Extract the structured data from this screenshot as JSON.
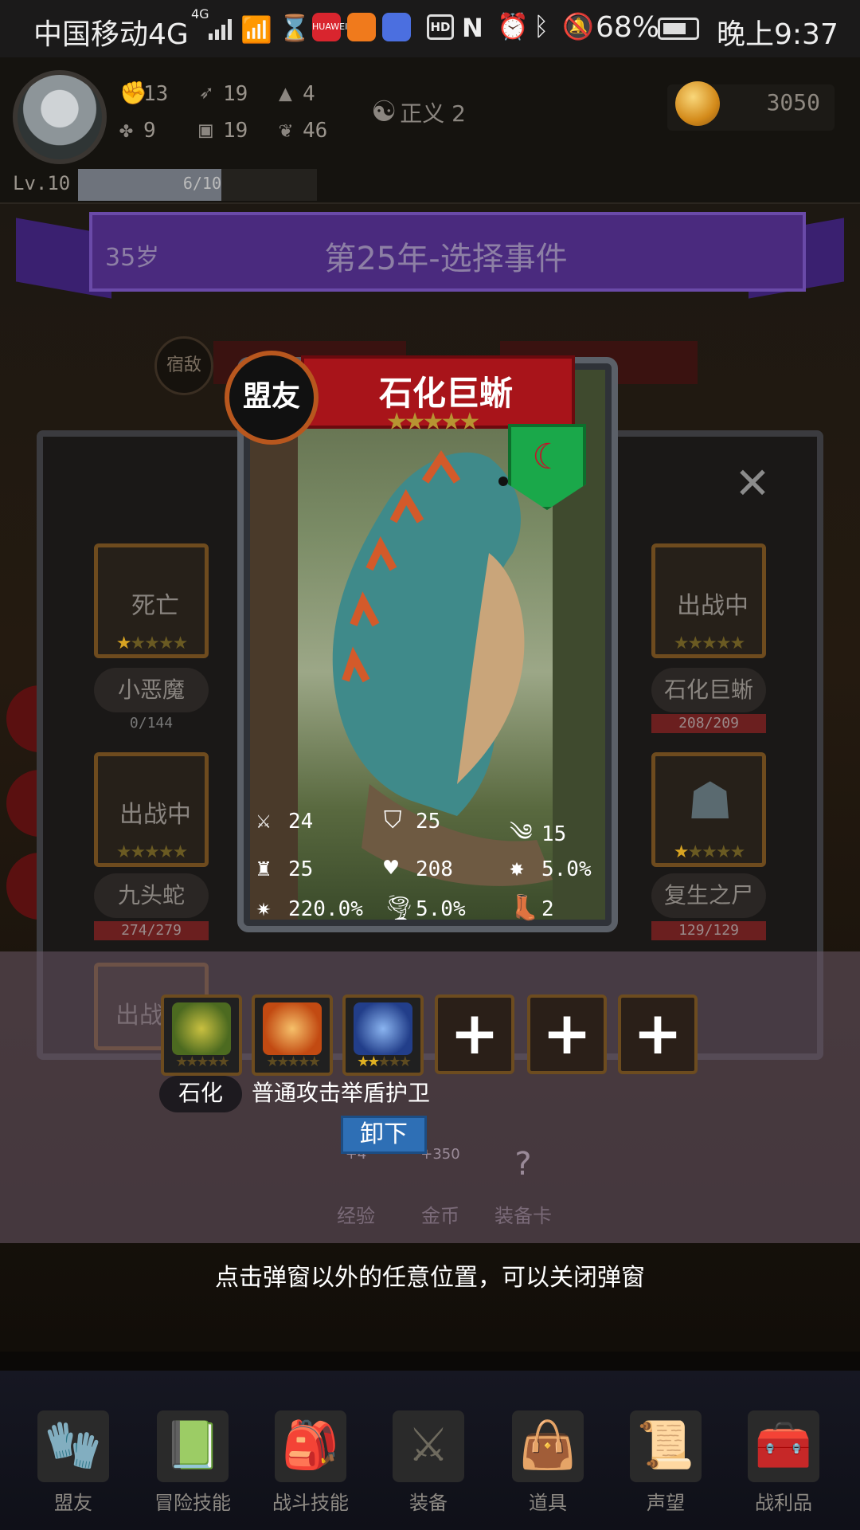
{
  "status_bar": {
    "carrier": "中国移动4G",
    "network_badge": "4G",
    "huawei_icon": "HUAWEI",
    "hd": "HD",
    "battery": "68%",
    "time": "晚上9:37"
  },
  "player": {
    "stats": [
      {
        "icon": "fist-icon",
        "value": "13"
      },
      {
        "icon": "feather-icon",
        "value": "19"
      },
      {
        "icon": "wizard-hat-icon",
        "value": "4"
      },
      {
        "icon": "clover-icon",
        "value": "9"
      },
      {
        "icon": "armor-icon",
        "value": "19"
      },
      {
        "icon": "leaf-icon",
        "value": "46"
      }
    ],
    "justice": "正义 2",
    "coins": "3050",
    "level": "Lv.10",
    "xp_text": "6/10",
    "xp_fraction": 0.6
  },
  "event": {
    "age": "35岁",
    "title": "第25年-选择事件",
    "bg_tag": "宿敌"
  },
  "left_column": [
    {
      "slot_text": "死亡",
      "name": "小恶魔",
      "hp": "0/144"
    },
    {
      "slot_text": "出战中",
      "name": "九头蛇",
      "hp": "274/279"
    },
    {
      "slot_text": "出战"
    }
  ],
  "right_column": [
    {
      "slot_text": "出战中",
      "name": "石化巨蜥",
      "hp": "208/209"
    },
    {
      "name": "复生之尸",
      "hp": "129/129"
    }
  ],
  "card": {
    "tag": "盟友",
    "name": "石化巨蜥",
    "star_count": 5,
    "stats": [
      {
        "icon": "sword-icon",
        "value": "24"
      },
      {
        "icon": "shield-icon",
        "value": "25"
      },
      {
        "icon": "wind-icon",
        "value": "15"
      },
      {
        "icon": "hood-icon",
        "value": "25"
      },
      {
        "icon": "heart-icon",
        "value": "208"
      },
      {
        "icon": "burst-icon",
        "value": "5.0%"
      },
      {
        "icon": "crit-icon",
        "value": "220.0%"
      },
      {
        "icon": "tornado-icon",
        "value": "5.0%"
      },
      {
        "icon": "boot-icon",
        "value": "2"
      }
    ]
  },
  "skills": [
    {
      "name": "石化",
      "icon": "petrify-icon"
    },
    {
      "name": "普通攻击",
      "icon": "axe-strike-icon"
    },
    {
      "name": "举盾护卫",
      "icon": "shield-guard-icon"
    }
  ],
  "add_slots": [
    "+",
    "+",
    "+"
  ],
  "unequip_label": "卸下",
  "hint": "点击弹窗以外的任意位置，可以关闭弹窗",
  "bg_rewards": [
    {
      "label": "经验",
      "value": "+4"
    },
    {
      "label": "金币",
      "value": "+350"
    },
    {
      "label": "装备卡",
      "value": "?"
    }
  ],
  "nav": [
    {
      "label": "盟友",
      "icon": "gloves-icon"
    },
    {
      "label": "冒险技能",
      "icon": "book-icon"
    },
    {
      "label": "战斗技能",
      "icon": "backpack-icon"
    },
    {
      "label": "装备",
      "icon": "crossed-swords-icon"
    },
    {
      "label": "道具",
      "icon": "bag-icon"
    },
    {
      "label": "声望",
      "icon": "scroll-icon"
    },
    {
      "label": "战利品",
      "icon": "chest-icon"
    }
  ],
  "colors": {
    "banner": "#4a2a7e",
    "card_ribbon": "#a8141a",
    "shield": "#1aa84a",
    "unequip": "#2e6fb5"
  }
}
